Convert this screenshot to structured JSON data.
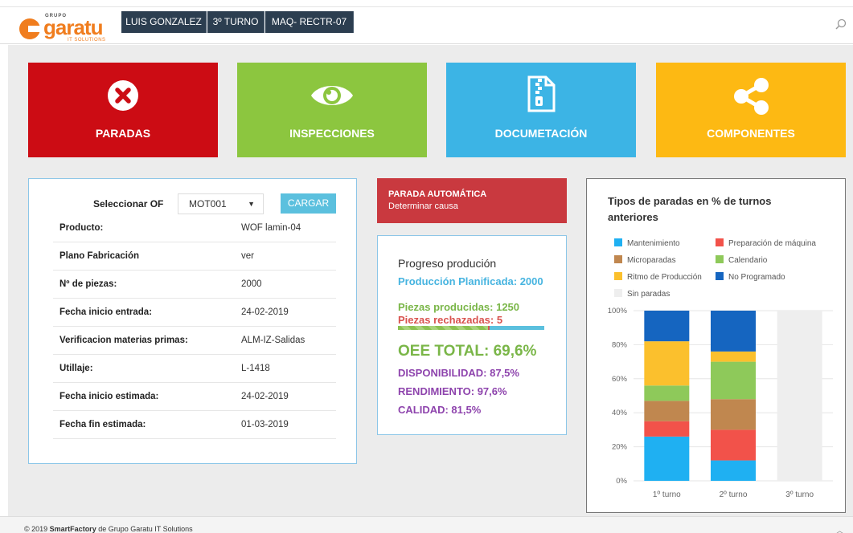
{
  "header": {
    "logo": {
      "group": "GRUPO",
      "name": "garatu",
      "subtitle": "IT SOLUTIONS"
    },
    "user": "LUIS GONZALEZ",
    "shift": "3º TURNO",
    "machine": "MAQ- RECTR-07",
    "search_icon": "search-icon"
  },
  "tiles": [
    {
      "label": "PARADAS",
      "icon": "close-circle-icon",
      "color": "#cc0c14"
    },
    {
      "label": "INSPECCIONES",
      "icon": "eye-icon",
      "color": "#8cc63f"
    },
    {
      "label": "DOCUMETACIÓN",
      "icon": "zip-file-icon",
      "color": "#3cb4e5"
    },
    {
      "label": "COMPONENTES",
      "icon": "share-icon",
      "color": "#fdb913"
    }
  ],
  "form": {
    "select_label": "Seleccionar OF",
    "select_value": "MOT001",
    "load_button": "CARGAR",
    "rows": [
      {
        "label": "Producto:",
        "value": "WOF lamin-04"
      },
      {
        "label": "Plano Fabricación",
        "value": "ver"
      },
      {
        "label": "Nº de piezas:",
        "value": "2000"
      },
      {
        "label": "Fecha inicio entrada:",
        "value": "24-02-2019"
      },
      {
        "label": "Verificacion materias primas:",
        "value": "ALM-IZ-Salidas"
      },
      {
        "label": "Utillaje:",
        "value": "L-1418"
      },
      {
        "label": "Fecha inicio estimada:",
        "value": "24-02-2019"
      },
      {
        "label": "Fecha fin estimada:",
        "value": "01-03-2019"
      }
    ]
  },
  "parada": {
    "title": "PARADA AUTOMÁTICA",
    "subtitle": "Determinar causa"
  },
  "progress": {
    "title": "Progreso produción",
    "planned": "Producción Planificada: 2000",
    "produced": "Piezas producidas: 1250",
    "rejected": "Piezas rechazadas: 5",
    "bar_fraction": 0.625,
    "oee": "OEE TOTAL: 69,6%",
    "availability": "DISPONIBILIDAD: 87,5%",
    "performance": "RENDIMIENTO: 97,6%",
    "quality": "CALIDAD: 81,5%"
  },
  "chart_data": {
    "type": "bar",
    "stacked": true,
    "title": "Tipos de paradas en % de turnos anteriores",
    "categories": [
      "1º turno",
      "2º turno",
      "3º turno"
    ],
    "yticks": [
      "0%",
      "20%",
      "40%",
      "60%",
      "80%",
      "100%"
    ],
    "ylim": [
      0,
      100
    ],
    "legend_placement": "top",
    "series": [
      {
        "name": "Mantenimiento",
        "color": "#1fb0f2",
        "values": [
          26,
          12,
          0
        ]
      },
      {
        "name": "Preparación de máquina",
        "color": "#f2524a",
        "values": [
          9,
          18,
          0
        ]
      },
      {
        "name": "Microparadas",
        "color": "#c0874f",
        "values": [
          12,
          18,
          0
        ]
      },
      {
        "name": "Calendario",
        "color": "#8ec95a",
        "values": [
          9,
          22,
          0
        ]
      },
      {
        "name": "Ritmo de Producción",
        "color": "#fbc02d",
        "values": [
          26,
          6,
          0
        ]
      },
      {
        "name": "No Programado",
        "color": "#1565c0",
        "values": [
          18,
          24,
          0
        ]
      },
      {
        "name": "Sin paradas",
        "color": "#eeeeee",
        "values": [
          0,
          0,
          100
        ]
      }
    ]
  },
  "footer": {
    "year": "© 2019",
    "brand": "SmartFactory",
    "rest": "de Grupo Garatu IT Solutions"
  }
}
